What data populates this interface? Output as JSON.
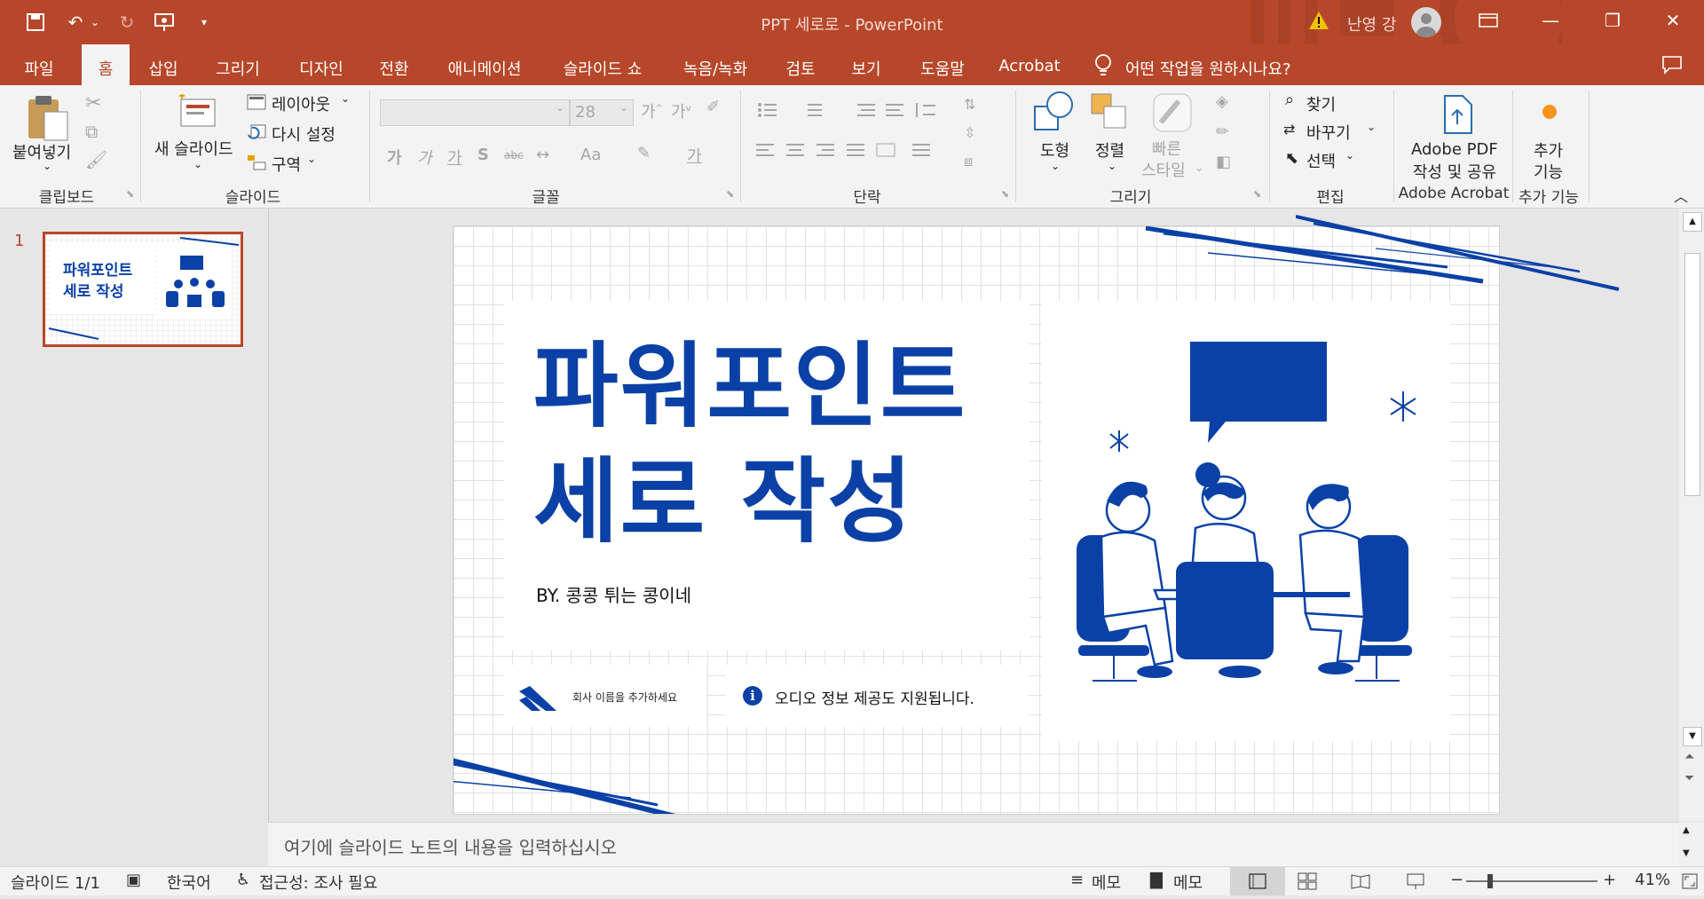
{
  "app": {
    "doc_title": "PPT 세로로 - PowerPoint",
    "user_name": "난영 강",
    "accent": "#b7472a"
  },
  "tabs": [
    "파일",
    "홈",
    "삽입",
    "그리기",
    "디자인",
    "전환",
    "애니메이션",
    "슬라이드 쇼",
    "녹음/녹화",
    "검토",
    "보기",
    "도움말",
    "Acrobat"
  ],
  "tell_me": "어떤 작업을 원하시나요?",
  "ribbon": {
    "clipboard": {
      "paste": "붙여넣기",
      "label": "클립보드"
    },
    "slides": {
      "new_slide": "새 슬라이드",
      "layout": "레이아웃",
      "reset": "다시 설정",
      "section": "구역",
      "label": "슬라이드"
    },
    "font": {
      "size": "28",
      "label": "글꼴",
      "glyph_a": "가",
      "glyph_b": "가",
      "glyph_c": "가",
      "glyph_s": "S",
      "glyph_aa": "Aa"
    },
    "paragraph": {
      "label": "단락"
    },
    "drawing": {
      "shapes": "도형",
      "arrange": "정렬",
      "quick_styles_1": "빠른",
      "quick_styles_2": "스타일",
      "label": "그리기"
    },
    "editing": {
      "find": "찾기",
      "replace": "바꾸기",
      "select": "선택",
      "label": "편집"
    },
    "acrobat": {
      "line1": "Adobe PDF",
      "line2": "작성 및 공유",
      "label": "Adobe Acrobat"
    },
    "addins": {
      "line1": "추가",
      "line2": "기능",
      "label": "추가 기능"
    }
  },
  "thumbnails": [
    {
      "number": "1",
      "title_line1": "파워포인트",
      "title_line2": "세로 작성"
    }
  ],
  "slide": {
    "title_line1": "파워포인트",
    "title_line2": "세로 작성",
    "byline": "BY. 콩콩 튀는 콩이네",
    "company": "회사 이름을 추가하세요",
    "info": "오디오 정보 제공도 지원됩니다.",
    "brand_color": "#0b41a6"
  },
  "notes_placeholder": "여기에 슬라이드 노트의 내용을 입력하십시오",
  "status": {
    "slide_counter": "슬라이드 1/1",
    "language": "한국어",
    "accessibility": "접근성: 조사 필요",
    "notes_1": "메모",
    "notes_2": "메모",
    "zoom": "41%"
  }
}
